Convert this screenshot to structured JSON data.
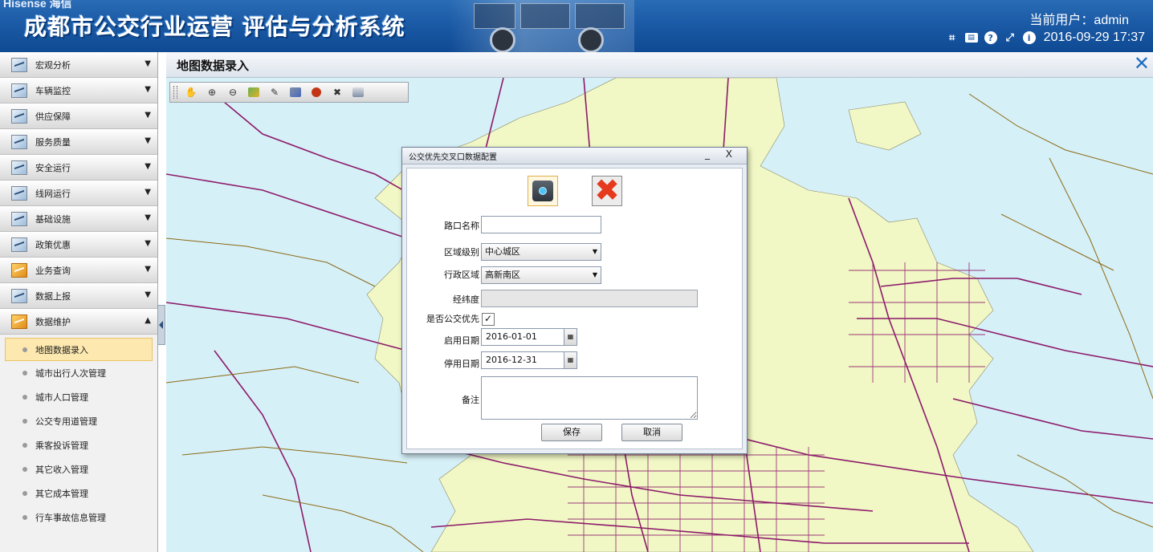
{
  "header": {
    "brand": "Hisense 海信",
    "system_title": "成都市公交行业运营 评估与分析系统",
    "current_user_label": "当前用户：",
    "current_user": "admin",
    "datetime": "2016-09-29 17:37",
    "toolbar_icons": [
      "crop-icon",
      "keyboard-icon",
      "help-icon",
      "fullscreen-icon",
      "info-icon"
    ]
  },
  "sidebar": {
    "items": [
      {
        "label": "宏观分析",
        "icon": "chart-line-icon",
        "chevron": "⌄"
      },
      {
        "label": "车辆监控",
        "icon": "camera-icon",
        "chevron": "⌄"
      },
      {
        "label": "供应保障",
        "icon": "supply-icon",
        "chevron": "⌄"
      },
      {
        "label": "服务质量",
        "icon": "service-icon",
        "chevron": "⌄"
      },
      {
        "label": "安全运行",
        "icon": "safety-icon",
        "chevron": "⌄"
      },
      {
        "label": "线网运行",
        "icon": "network-icon",
        "chevron": "⌄"
      },
      {
        "label": "基础设施",
        "icon": "infrastructure-icon",
        "chevron": "⌄"
      },
      {
        "label": "政策优惠",
        "icon": "policy-icon",
        "chevron": "⌄"
      },
      {
        "label": "业务查询",
        "icon": "query-icon",
        "chevron": "⌄"
      },
      {
        "label": "数据上报",
        "icon": "report-icon",
        "chevron": "⌄"
      },
      {
        "label": "数据维护",
        "icon": "maintenance-icon",
        "chevron": "⌃"
      }
    ],
    "sub_items": [
      {
        "label": "地图数据录入",
        "active": true
      },
      {
        "label": "城市出行人次管理"
      },
      {
        "label": "城市人口管理"
      },
      {
        "label": "公交专用道管理"
      },
      {
        "label": "乘客投诉管理"
      },
      {
        "label": "其它收入管理"
      },
      {
        "label": "其它成本管理"
      },
      {
        "label": "行车事故信息管理"
      }
    ]
  },
  "main": {
    "title": "地图数据录入",
    "close_glyph": "✕",
    "map_tools": [
      "pan-icon",
      "zoom-in-icon",
      "zoom-out-icon",
      "full-extent-icon",
      "edit-icon",
      "layer-icon",
      "location-icon",
      "clear-icon",
      "table-icon"
    ]
  },
  "dialog": {
    "title": "公交优先交叉口数据配置",
    "window_buttons": "_ X",
    "fields": {
      "name_label": "路口名称",
      "name_value": "",
      "level_label": "区域级别",
      "level_value": "中心城区",
      "district_label": "行政区域",
      "district_value": "高新南区",
      "coord_label": "经纬度",
      "coord_value": "",
      "priority_label": "是否公交优先",
      "priority_checked": true,
      "start_label": "启用日期",
      "start_value": "2016-01-01",
      "end_label": "停用日期",
      "end_value": "2016-12-31",
      "remark_label": "备注",
      "remark_value": ""
    },
    "save_label": "保存",
    "cancel_label": "取消"
  },
  "colors": {
    "header_blue": "#1b5aa6",
    "map_water": "#d6f0f7",
    "map_land": "#f1f7c5",
    "road_purple": "#8c1a6a",
    "road_brown": "#8b6a15"
  }
}
